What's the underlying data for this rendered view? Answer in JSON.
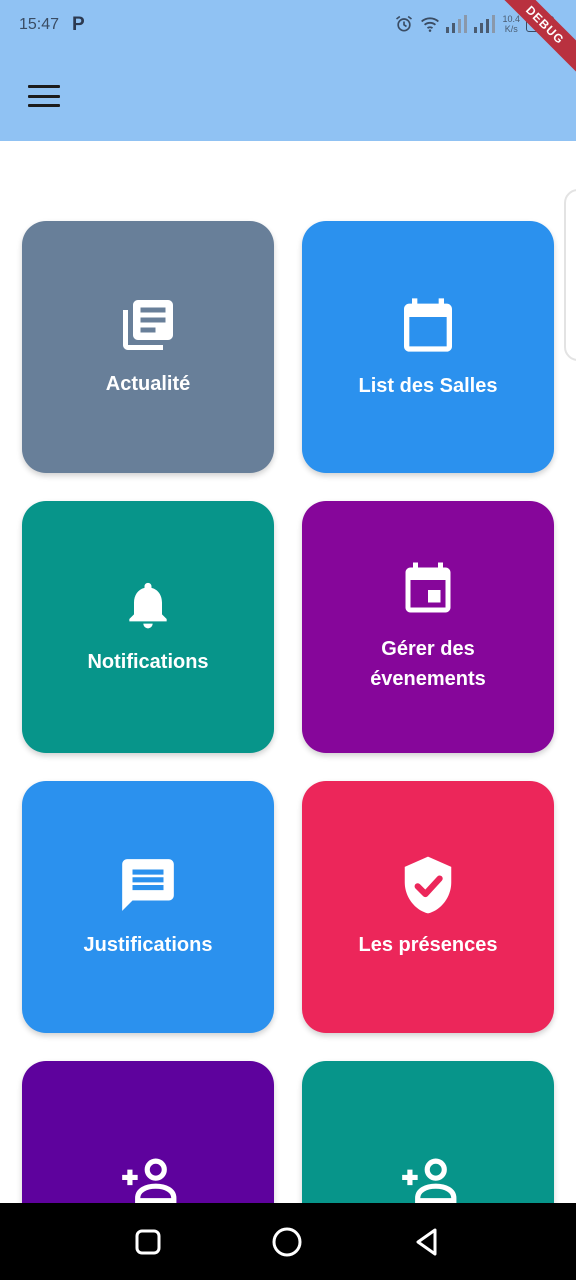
{
  "status_bar": {
    "time": "15:47",
    "app_letter": "P",
    "speed_value": "10.4",
    "speed_unit": "K/s",
    "battery": "24"
  },
  "debug_banner": "DEBUG",
  "app_bar": {
    "color": "#90c2f3",
    "menu_icon": "hamburger-menu-icon"
  },
  "tiles": [
    {
      "label": "Actualité",
      "icon": "newspaper-icon",
      "color": "#687f99"
    },
    {
      "label": "List des Salles",
      "icon": "calendar-icon",
      "color": "#2b91ee"
    },
    {
      "label": "Notifications",
      "icon": "bell-icon",
      "color": "#07958a"
    },
    {
      "label": "Gérer des évenements",
      "icon": "event-icon",
      "color": "#86069a"
    },
    {
      "label": "Justifications",
      "icon": "message-icon",
      "color": "#2b91ee"
    },
    {
      "label": "Les présences",
      "icon": "verified-shield-icon",
      "color": "#ec265a"
    },
    {
      "label": "",
      "icon": "person-add-icon",
      "color": "#5e029d"
    },
    {
      "label": "",
      "icon": "person-add-icon",
      "color": "#07958a"
    }
  ],
  "nav_bar": {
    "recents_icon": "square-icon",
    "home_icon": "circle-icon",
    "back_icon": "triangle-back-icon"
  }
}
